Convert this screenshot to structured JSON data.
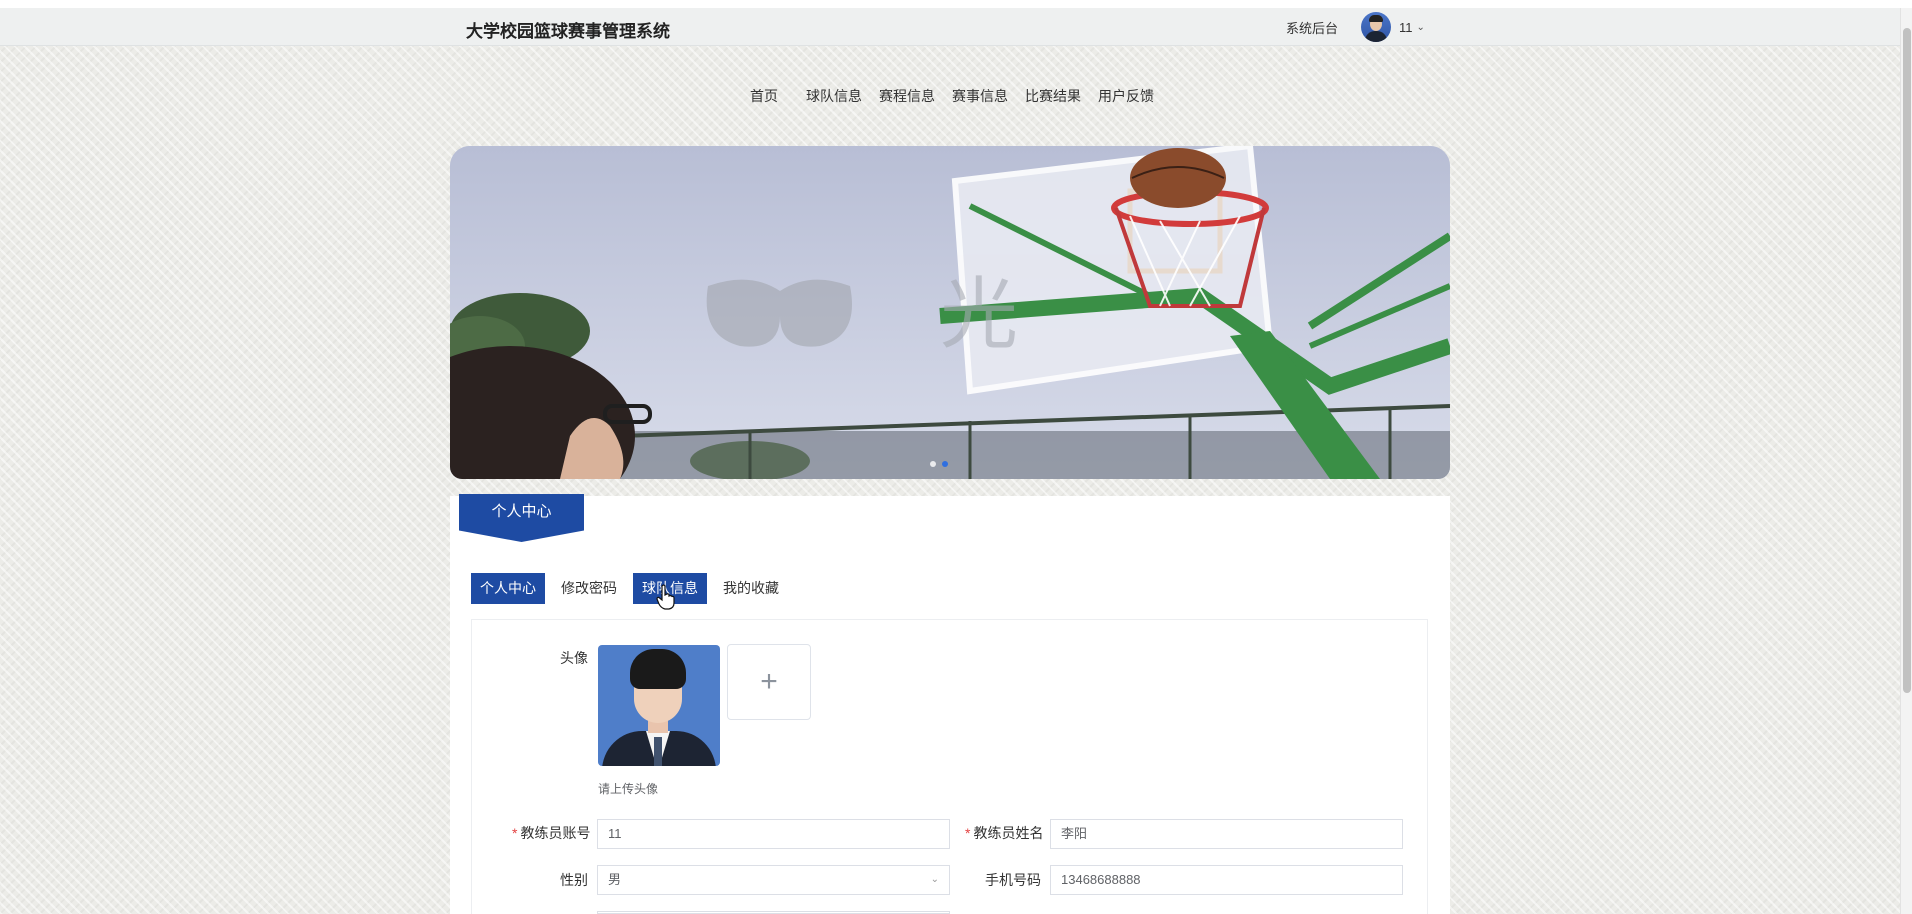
{
  "header": {
    "site_title": "大学校园篮球赛事管理系统",
    "backend_link": "系统后台",
    "user_name": "11"
  },
  "nav": {
    "items": [
      "首页",
      "球队信息",
      "赛程信息",
      "赛事信息",
      "比赛结果",
      "用户反馈"
    ]
  },
  "banner": {
    "watermark_text": "光",
    "slide_count": 2,
    "active_slide": 2
  },
  "section": {
    "tag_label": "个人中心"
  },
  "tabs": {
    "items": [
      "个人中心",
      "修改密码",
      "球队信息",
      "我的收藏"
    ],
    "active": [
      "个人中心",
      "球队信息"
    ]
  },
  "form": {
    "avatar_label": "头像",
    "upload_icon": "+",
    "avatar_hint": "请上传头像",
    "account_label": "教练员账号",
    "account_value": "11",
    "name_label": "教练员姓名",
    "name_value": "李阳",
    "gender_label": "性别",
    "gender_value": "男",
    "phone_label": "手机号码",
    "phone_value": "13468688888"
  },
  "icons": {
    "dropdown": "chevron-down-icon",
    "select_arrow": "chevron-down-icon",
    "upload": "plus-icon",
    "cursor": "hand-pointer-icon"
  },
  "colors": {
    "primary": "#1e4ba3",
    "required": "#e34141",
    "active_dot": "#2f6fe0"
  }
}
